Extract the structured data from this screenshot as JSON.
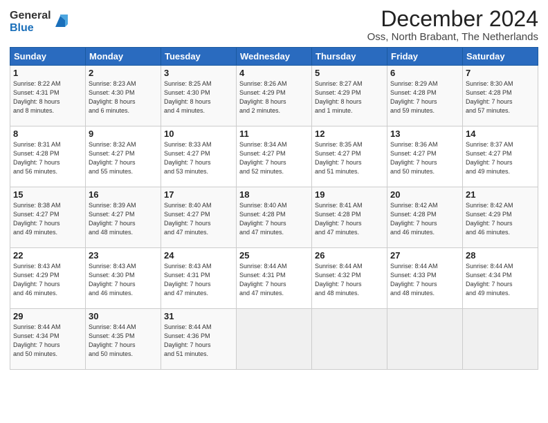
{
  "logo": {
    "general": "General",
    "blue": "Blue"
  },
  "title": "December 2024",
  "subtitle": "Oss, North Brabant, The Netherlands",
  "days_of_week": [
    "Sunday",
    "Monday",
    "Tuesday",
    "Wednesday",
    "Thursday",
    "Friday",
    "Saturday"
  ],
  "weeks": [
    [
      {
        "day": "1",
        "info": "Sunrise: 8:22 AM\nSunset: 4:31 PM\nDaylight: 8 hours\nand 8 minutes."
      },
      {
        "day": "2",
        "info": "Sunrise: 8:23 AM\nSunset: 4:30 PM\nDaylight: 8 hours\nand 6 minutes."
      },
      {
        "day": "3",
        "info": "Sunrise: 8:25 AM\nSunset: 4:30 PM\nDaylight: 8 hours\nand 4 minutes."
      },
      {
        "day": "4",
        "info": "Sunrise: 8:26 AM\nSunset: 4:29 PM\nDaylight: 8 hours\nand 2 minutes."
      },
      {
        "day": "5",
        "info": "Sunrise: 8:27 AM\nSunset: 4:29 PM\nDaylight: 8 hours\nand 1 minute."
      },
      {
        "day": "6",
        "info": "Sunrise: 8:29 AM\nSunset: 4:28 PM\nDaylight: 7 hours\nand 59 minutes."
      },
      {
        "day": "7",
        "info": "Sunrise: 8:30 AM\nSunset: 4:28 PM\nDaylight: 7 hours\nand 57 minutes."
      }
    ],
    [
      {
        "day": "8",
        "info": "Sunrise: 8:31 AM\nSunset: 4:28 PM\nDaylight: 7 hours\nand 56 minutes."
      },
      {
        "day": "9",
        "info": "Sunrise: 8:32 AM\nSunset: 4:27 PM\nDaylight: 7 hours\nand 55 minutes."
      },
      {
        "day": "10",
        "info": "Sunrise: 8:33 AM\nSunset: 4:27 PM\nDaylight: 7 hours\nand 53 minutes."
      },
      {
        "day": "11",
        "info": "Sunrise: 8:34 AM\nSunset: 4:27 PM\nDaylight: 7 hours\nand 52 minutes."
      },
      {
        "day": "12",
        "info": "Sunrise: 8:35 AM\nSunset: 4:27 PM\nDaylight: 7 hours\nand 51 minutes."
      },
      {
        "day": "13",
        "info": "Sunrise: 8:36 AM\nSunset: 4:27 PM\nDaylight: 7 hours\nand 50 minutes."
      },
      {
        "day": "14",
        "info": "Sunrise: 8:37 AM\nSunset: 4:27 PM\nDaylight: 7 hours\nand 49 minutes."
      }
    ],
    [
      {
        "day": "15",
        "info": "Sunrise: 8:38 AM\nSunset: 4:27 PM\nDaylight: 7 hours\nand 49 minutes."
      },
      {
        "day": "16",
        "info": "Sunrise: 8:39 AM\nSunset: 4:27 PM\nDaylight: 7 hours\nand 48 minutes."
      },
      {
        "day": "17",
        "info": "Sunrise: 8:40 AM\nSunset: 4:27 PM\nDaylight: 7 hours\nand 47 minutes."
      },
      {
        "day": "18",
        "info": "Sunrise: 8:40 AM\nSunset: 4:28 PM\nDaylight: 7 hours\nand 47 minutes."
      },
      {
        "day": "19",
        "info": "Sunrise: 8:41 AM\nSunset: 4:28 PM\nDaylight: 7 hours\nand 47 minutes."
      },
      {
        "day": "20",
        "info": "Sunrise: 8:42 AM\nSunset: 4:28 PM\nDaylight: 7 hours\nand 46 minutes."
      },
      {
        "day": "21",
        "info": "Sunrise: 8:42 AM\nSunset: 4:29 PM\nDaylight: 7 hours\nand 46 minutes."
      }
    ],
    [
      {
        "day": "22",
        "info": "Sunrise: 8:43 AM\nSunset: 4:29 PM\nDaylight: 7 hours\nand 46 minutes."
      },
      {
        "day": "23",
        "info": "Sunrise: 8:43 AM\nSunset: 4:30 PM\nDaylight: 7 hours\nand 46 minutes."
      },
      {
        "day": "24",
        "info": "Sunrise: 8:43 AM\nSunset: 4:31 PM\nDaylight: 7 hours\nand 47 minutes."
      },
      {
        "day": "25",
        "info": "Sunrise: 8:44 AM\nSunset: 4:31 PM\nDaylight: 7 hours\nand 47 minutes."
      },
      {
        "day": "26",
        "info": "Sunrise: 8:44 AM\nSunset: 4:32 PM\nDaylight: 7 hours\nand 48 minutes."
      },
      {
        "day": "27",
        "info": "Sunrise: 8:44 AM\nSunset: 4:33 PM\nDaylight: 7 hours\nand 48 minutes."
      },
      {
        "day": "28",
        "info": "Sunrise: 8:44 AM\nSunset: 4:34 PM\nDaylight: 7 hours\nand 49 minutes."
      }
    ],
    [
      {
        "day": "29",
        "info": "Sunrise: 8:44 AM\nSunset: 4:34 PM\nDaylight: 7 hours\nand 50 minutes."
      },
      {
        "day": "30",
        "info": "Sunrise: 8:44 AM\nSunset: 4:35 PM\nDaylight: 7 hours\nand 50 minutes."
      },
      {
        "day": "31",
        "info": "Sunrise: 8:44 AM\nSunset: 4:36 PM\nDaylight: 7 hours\nand 51 minutes."
      },
      {
        "day": "",
        "info": ""
      },
      {
        "day": "",
        "info": ""
      },
      {
        "day": "",
        "info": ""
      },
      {
        "day": "",
        "info": ""
      }
    ]
  ]
}
